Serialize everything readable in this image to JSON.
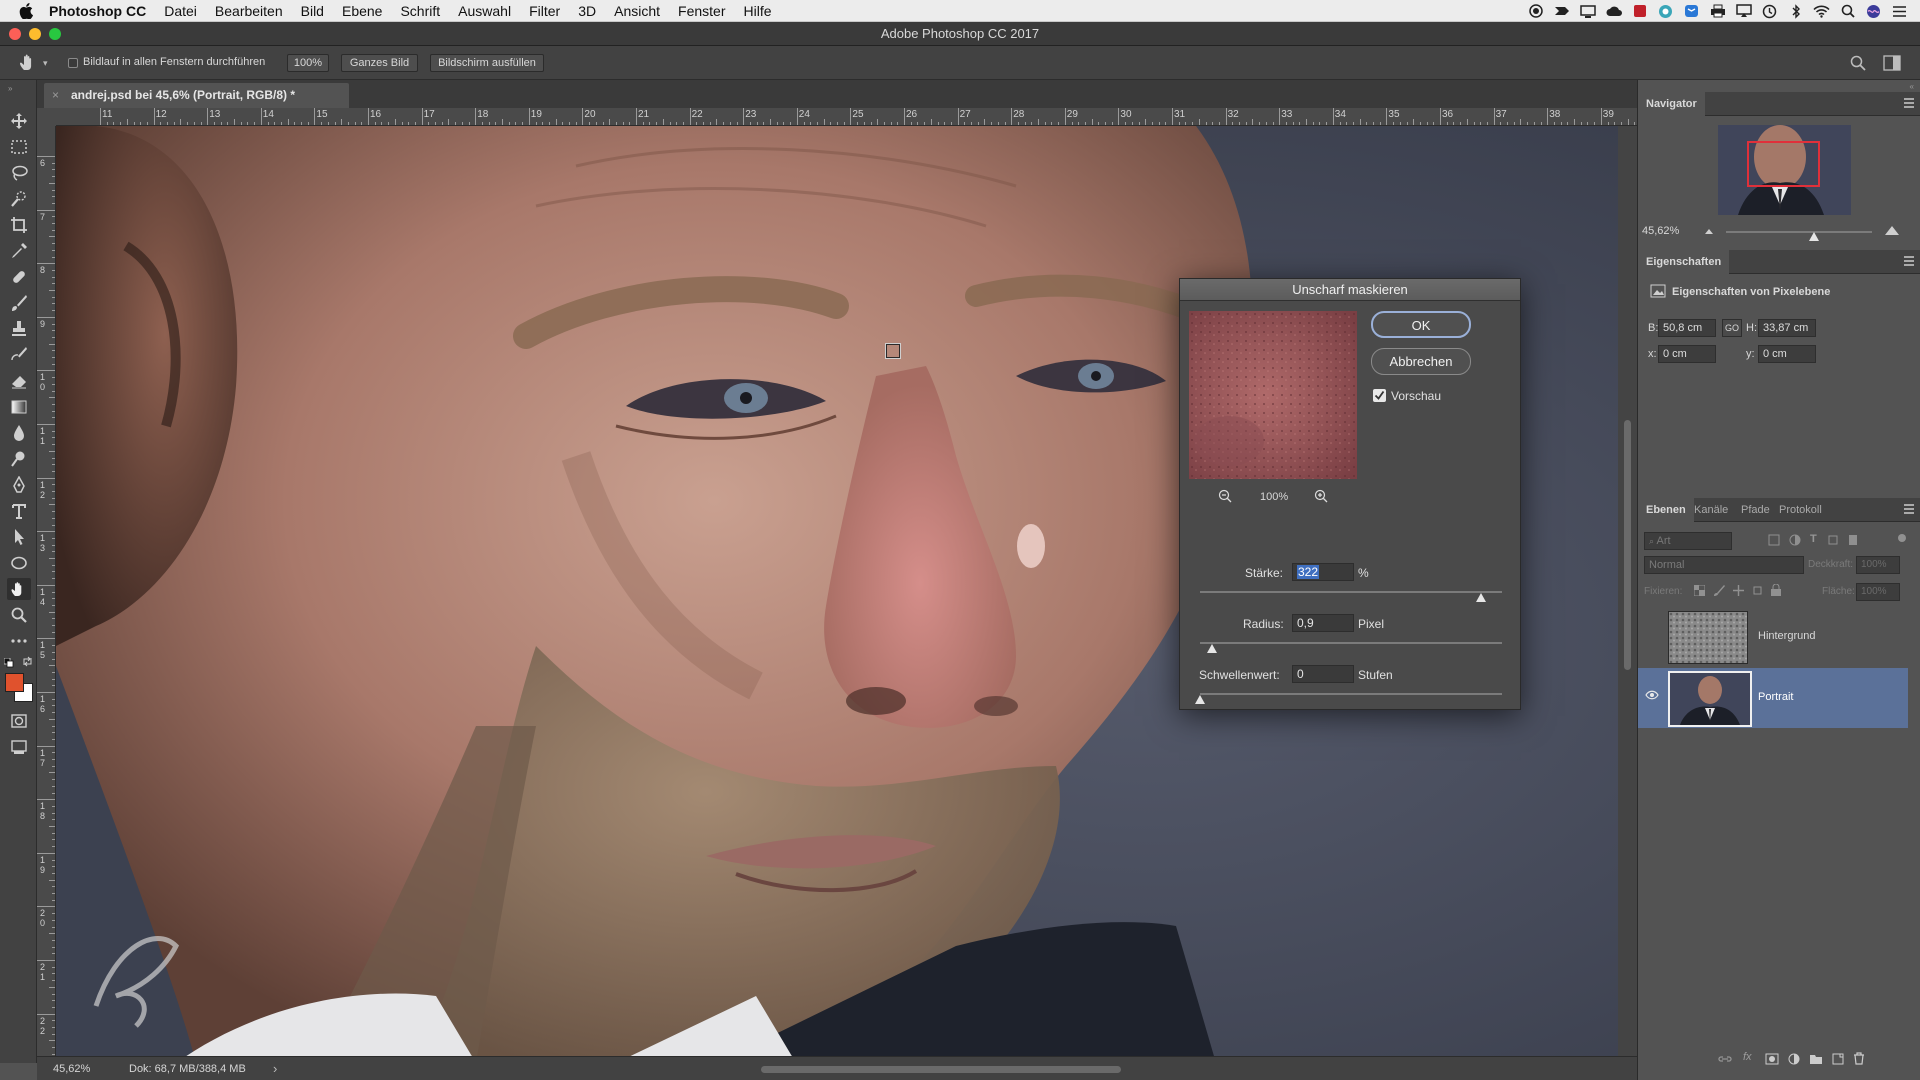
{
  "menubar": {
    "app_name": "Photoshop CC",
    "items": [
      "Datei",
      "Bearbeiten",
      "Bild",
      "Ebene",
      "Schrift",
      "Auswahl",
      "Filter",
      "3D",
      "Ansicht",
      "Fenster",
      "Hilfe"
    ]
  },
  "window": {
    "title": "Adobe Photoshop CC 2017"
  },
  "options_bar": {
    "scroll_all_label": "Bildlauf in allen Fenstern durchführen",
    "zoom100_label": "100%",
    "fit_label": "Ganzes Bild",
    "fill_label": "Bildschirm ausfüllen"
  },
  "document": {
    "tab_label": "andrej.psd bei 45,6% (Portrait, RGB/8) *",
    "close_glyph": "×"
  },
  "ruler": {
    "top_numbers": [
      "11",
      "12",
      "13",
      "14",
      "15",
      "16",
      "17",
      "18",
      "19",
      "20",
      "21",
      "22",
      "23",
      "24",
      "25",
      "26",
      "27",
      "28",
      "29",
      "30",
      "31",
      "32",
      "33",
      "34",
      "35",
      "36",
      "37",
      "38",
      "39"
    ],
    "left_numbers": [
      "6",
      "7",
      "8",
      "9",
      "1 0",
      "1 1",
      "1 2",
      "1 3",
      "1 4",
      "1 5",
      "1 6",
      "1 7",
      "1 8",
      "1 9",
      "2 0",
      "2 1",
      "2 2"
    ]
  },
  "status_bar": {
    "zoom": "45,62%",
    "doc_info": "Dok: 68,7 MB/388,4 MB",
    "arrow": "›"
  },
  "navigator": {
    "tab_label": "Navigator",
    "zoom": "45,62%",
    "slider_position": 0.6
  },
  "properties": {
    "tab_label": "Eigenschaften",
    "header": "Eigenschaften von Pixelebene",
    "w_label": "B:",
    "w_value": "50,8 cm",
    "link_label": "GO",
    "h_label": "H:",
    "h_value": "33,87 cm",
    "x_label": "x:",
    "x_value": "0 cm",
    "y_label": "y:",
    "y_value": "0 cm"
  },
  "layers_panel": {
    "tabs": [
      "Ebenen",
      "Kanäle",
      "Pfade",
      "Protokoll"
    ],
    "search_placeholder": "Art",
    "blend_mode": "Normal",
    "opacity_label": "Deckkraft:",
    "opacity_value": "100%",
    "lock_label": "Fixieren:",
    "fill_label": "Fläche:",
    "fill_value": "100%",
    "layers": [
      {
        "name": "Hintergrund",
        "visible": false,
        "selected": false
      },
      {
        "name": "Portrait",
        "visible": true,
        "selected": true
      }
    ]
  },
  "dialog": {
    "title": "Unscharf maskieren",
    "ok_label": "OK",
    "cancel_label": "Abbrechen",
    "preview_label": "Vorschau",
    "preview_checked": true,
    "preview_zoom": "100%",
    "amount_label": "Stärke:",
    "amount_value": "322",
    "amount_unit": "%",
    "amount_position": 0.93,
    "radius_label": "Radius:",
    "radius_value": "0,9",
    "radius_unit": "Pixel",
    "radius_position": 0.04,
    "threshold_label": "Schwellenwert:",
    "threshold_value": "0",
    "threshold_unit": "Stufen",
    "threshold_position": 0.0
  },
  "colors": {
    "foreground": "#e0522d",
    "background": "#ffffff",
    "selection_highlight": "#5b7199",
    "navigator_box": "#e0303a"
  }
}
